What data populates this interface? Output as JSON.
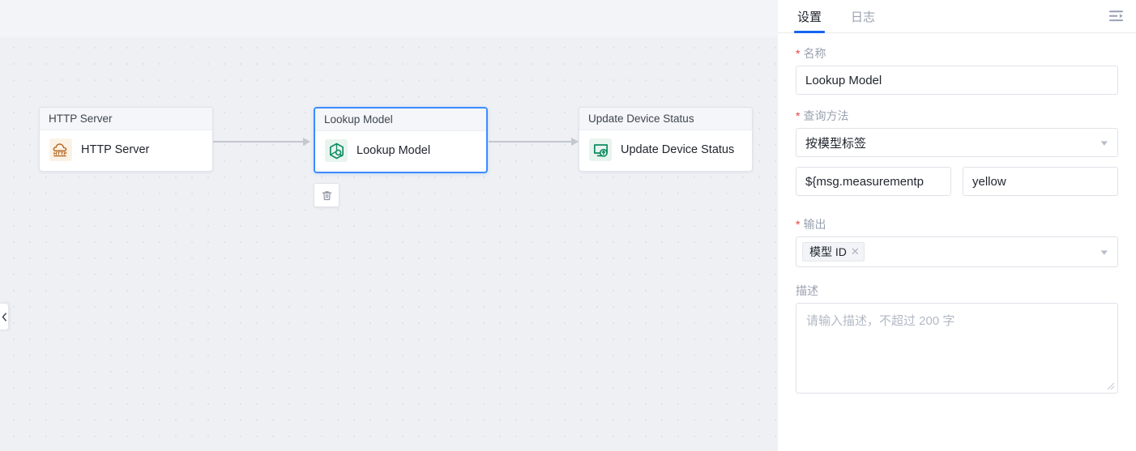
{
  "editor": {
    "title_tab": "Lookup Model",
    "collapse_handle_icon": "chevron-left-icon",
    "node_toolbar": {
      "delete_icon": "trash-icon"
    },
    "nodes": [
      {
        "id": "http-server",
        "header": "HTTP Server",
        "label": "HTTP Server",
        "icon": "http-cloud-icon",
        "icon_text": "HTTP",
        "selected": false
      },
      {
        "id": "lookup-model",
        "header": "Lookup Model",
        "label": "Lookup Model",
        "icon": "hexagon-search-icon",
        "selected": true
      },
      {
        "id": "update-device-status",
        "header": "Update Device Status",
        "label": "Update Device Status",
        "icon": "monitor-update-icon",
        "selected": false
      }
    ]
  },
  "panel": {
    "tabs": [
      {
        "label": "设置",
        "active": true
      },
      {
        "label": "日志",
        "active": false
      }
    ],
    "menu_icon": "menu-fold-icon",
    "fields": {
      "name": {
        "label": "名称",
        "required": true,
        "value": "Lookup Model"
      },
      "query_method": {
        "label": "查询方法",
        "required": true,
        "value": "按模型标签",
        "caret_icon": "chevron-down-icon",
        "key_value": "${msg.measurementp",
        "value_value": "yellow"
      },
      "output": {
        "label": "输出",
        "required": true,
        "tags": [
          "模型 ID"
        ],
        "tag_remove_icon": "close-icon",
        "caret_icon": "chevron-down-icon"
      },
      "description": {
        "label": "描述",
        "required": false,
        "placeholder": "请输入描述，不超过 200 字",
        "value": ""
      }
    }
  },
  "colors": {
    "accent": "#1565f0",
    "node_selected_border": "#3d8bfd",
    "required_star": "#e8413c",
    "canvas_bg": "#eef0f4",
    "green_icon": "#0e8a62",
    "http_icon": "#b5651d"
  }
}
